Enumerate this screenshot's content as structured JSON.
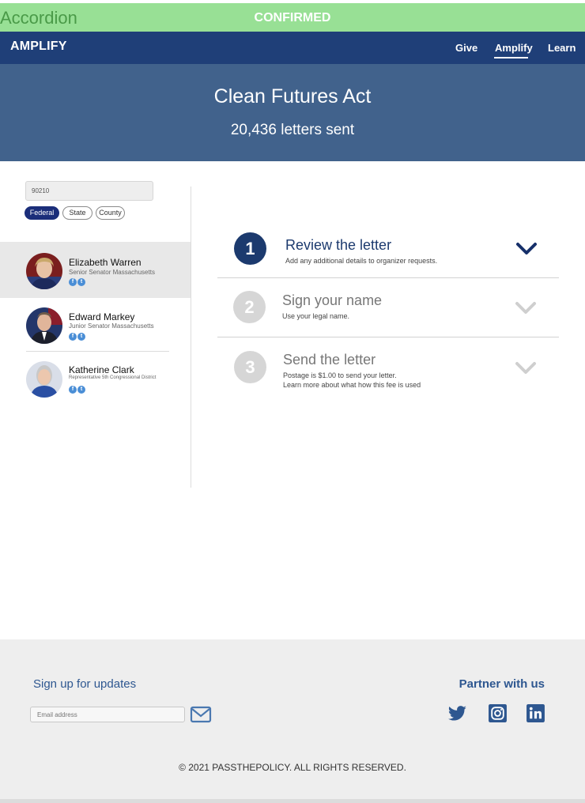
{
  "banner": {
    "title": "Accordion",
    "state": "CONFIRMED"
  },
  "nav": {
    "brand": "AMPLIFY",
    "links": [
      "Give",
      "Amplify",
      "Learn"
    ],
    "active": "Amplify"
  },
  "hero": {
    "title": "Clean Futures Act",
    "subtitle": "20,436 letters sent"
  },
  "search": {
    "zip_value": "90210"
  },
  "filters": [
    "Federal",
    "State",
    "County"
  ],
  "representatives": [
    {
      "name": "Elizabeth Warren",
      "role": "Senior Senator Massachusetts",
      "active": true
    },
    {
      "name": "Edward Markey",
      "role": "Junior Senator Massachusetts",
      "active": false
    },
    {
      "name": "Katherine Clark",
      "role": "Representative 5th Congressional District",
      "active": false
    }
  ],
  "steps": [
    {
      "number": "1",
      "title": "Review the letter",
      "description": "Add any additional details to organizer requests.",
      "active": true
    },
    {
      "number": "2",
      "title": "Sign your name",
      "description": "Use your legal name.",
      "active": false
    },
    {
      "number": "3",
      "title": "Send the letter",
      "description": "Postage is $1.00 to send your letter.",
      "description2": "Learn more about what how this fee is used",
      "active": false
    }
  ],
  "footer": {
    "signup_title": "Sign up for updates",
    "email_placeholder": "Email address",
    "partner_title": "Partner with us",
    "social_icons": [
      "twitter-icon",
      "instagram-icon",
      "linkedin-icon"
    ],
    "copyright": "© 2021 PASSTHEPOLICY. ALL RIGHTS RESERVED."
  },
  "colors": {
    "navy": "#1f3f78",
    "hero": "#41628c",
    "banner": "#98e095",
    "step_active": "#1c3a6e",
    "step_inactive": "#d6d6d6"
  }
}
